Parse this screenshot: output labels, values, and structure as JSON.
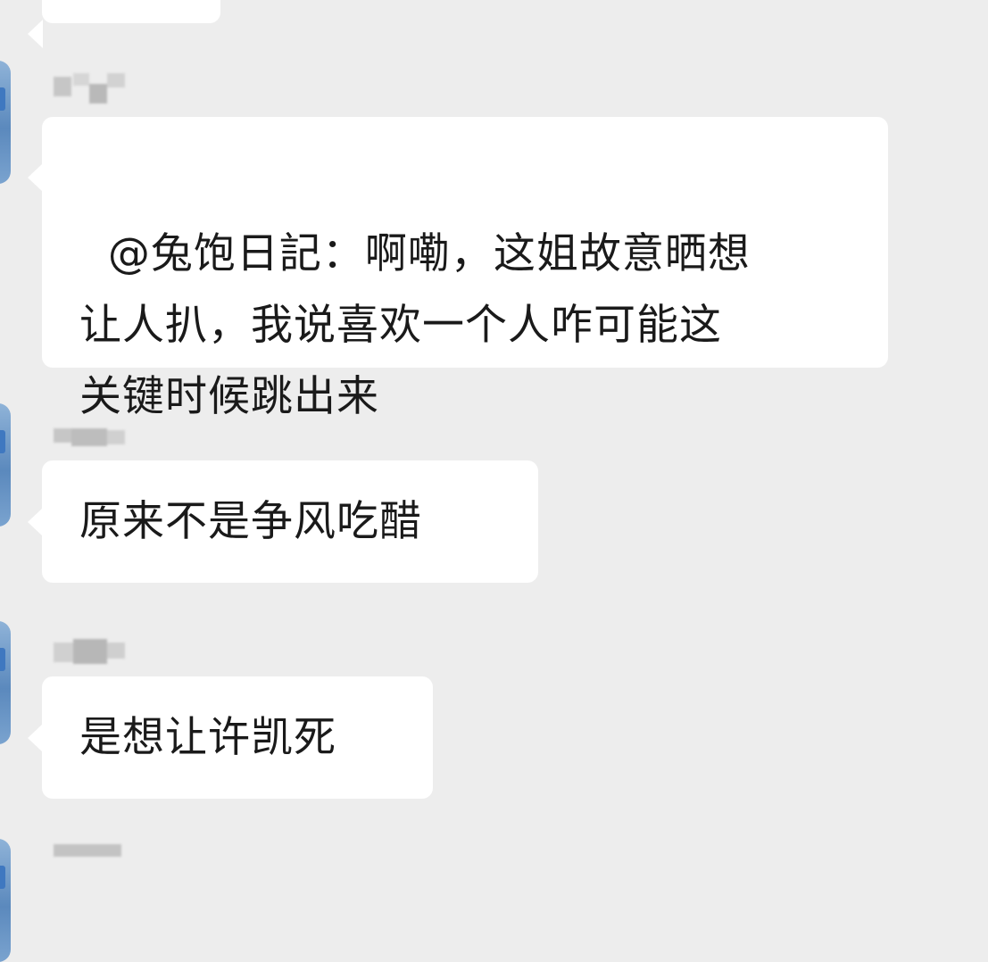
{
  "messages": [
    {
      "text": "@兔饱日記：啊嘞，这姐故意晒想\n让人扒，我说喜欢一个人咋可能这\n关键时候跳出来"
    },
    {
      "text": "原来不是争风吃醋"
    },
    {
      "text": "是想让许凯死"
    }
  ],
  "colors": {
    "background": "#ededed",
    "bubble": "#ffffff",
    "text": "#1a1a1a"
  }
}
